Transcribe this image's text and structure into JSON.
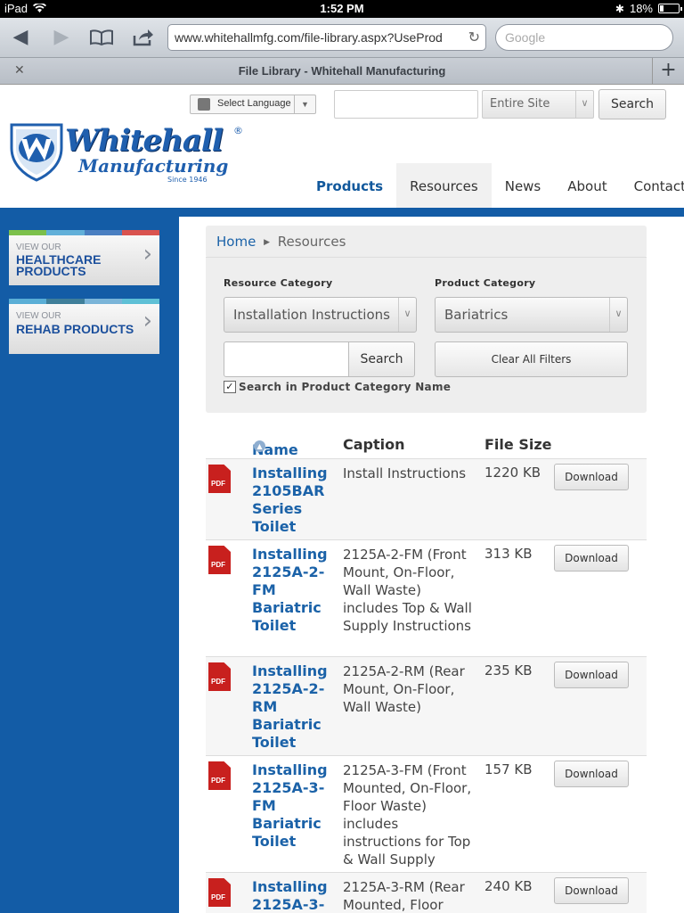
{
  "status_bar": {
    "device": "iPad",
    "time": "1:52 PM",
    "battery": "18%",
    "battery_level": 0.18
  },
  "browser": {
    "url": "www.whitehallmfg.com/file-library.aspx?UseProd",
    "search_placeholder": "Google",
    "tab_title": "File Library - Whitehall Manufacturing"
  },
  "header": {
    "language_label": "Select Language",
    "search_value": "",
    "scope_value": "Entire Site",
    "search_button": "Search",
    "logo": {
      "word": "Whitehall",
      "sub": "Manufacturing",
      "since": "Since 1946",
      "reg": "®"
    },
    "nav": [
      {
        "label": "Products"
      },
      {
        "label": "Resources"
      },
      {
        "label": "News"
      },
      {
        "label": "About"
      },
      {
        "label": "Contact"
      }
    ]
  },
  "sidebar": {
    "banners": [
      {
        "small": "VIEW OUR",
        "big_line1": "HEALTHCARE",
        "big_line2": "PRODUCTS",
        "stripe": [
          "#7cc04b",
          "#62b0d9",
          "#4a7fc1",
          "#d9534f"
        ]
      },
      {
        "small": "VIEW OUR",
        "big_line1": "REHAB PRODUCTS",
        "big_line2": "",
        "stripe": [
          "#5aaed6",
          "#3f7f9a",
          "#7ab4d8",
          "#5ec0d6"
        ]
      }
    ]
  },
  "breadcrumb": {
    "home": "Home",
    "current": "Resources"
  },
  "filters": {
    "resource_label": "Resource Category",
    "resource_value": "Installation Instructions",
    "product_label": "Product Category",
    "product_value": "Bariatrics",
    "search_value": "",
    "search_button": "Search",
    "clear_button": "Clear All Filters",
    "checkbox_label": "Search in Product Category Name",
    "checkbox_checked": true
  },
  "table": {
    "headers": {
      "name": "Name",
      "caption": "Caption",
      "size": "File Size"
    },
    "rows": [
      {
        "name": "Installing 2105BAR Series Toilet",
        "caption": "Install Instructions",
        "size": "1220 KB",
        "action": "Download"
      },
      {
        "name": "Installing 2125A-2-FM Bariatric Toilet",
        "caption": "2125A-2-FM (Front Mount, On-Floor, Wall Waste) includes Top & Wall Supply Instructions",
        "size": "313 KB",
        "action": "Download"
      },
      {
        "name": "Installing 2125A-2-RM Bariatric Toilet",
        "caption": "2125A-2-RM (Rear Mount, On-Floor, Wall Waste)",
        "size": "235 KB",
        "action": "Download"
      },
      {
        "name": "Installing 2125A-3-FM Bariatric Toilet",
        "caption": "2125A-3-FM (Front Mounted, On-Floor, Floor Waste) includes instructions for Top & Wall Supply",
        "size": "157 KB",
        "action": "Download"
      },
      {
        "name": "Installing 2125A-3-",
        "caption": "2125A-3-RM (Rear Mounted, Floor",
        "size": "240 KB",
        "action": "Download"
      }
    ]
  }
}
